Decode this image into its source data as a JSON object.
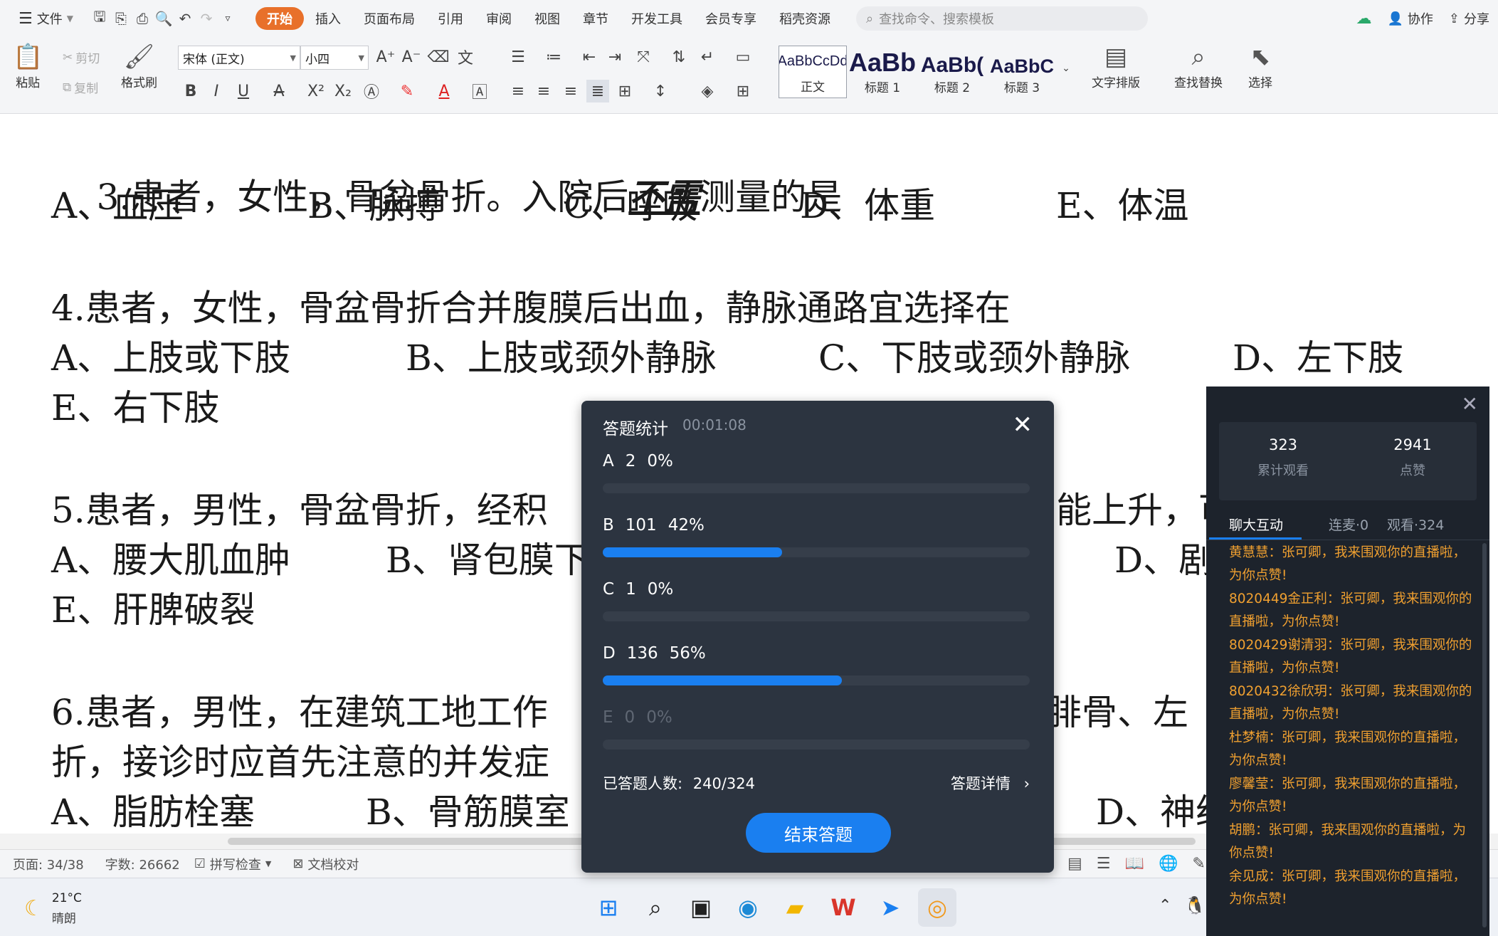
{
  "menu": {
    "file_label": "文件",
    "tabs": [
      "开始",
      "插入",
      "页面布局",
      "引用",
      "审阅",
      "视图",
      "章节",
      "开发工具",
      "会员专享",
      "稻壳资源"
    ],
    "search_placeholder": "查找命令、搜索模板",
    "collab_label": "协作",
    "share_label": "分享"
  },
  "ribbon": {
    "paste": "粘贴",
    "cut": "剪切",
    "copy": "复制",
    "format_painter": "格式刷",
    "font_name": "宋体 (正文)",
    "font_size": "小四",
    "styles": [
      {
        "sample": "AaBbCcDd",
        "label": "正文"
      },
      {
        "sample": "AaBb",
        "label": "标题 1"
      },
      {
        "sample": "AaBb(",
        "label": "标题 2"
      },
      {
        "sample": "AaBbC",
        "label": "标题 3"
      }
    ],
    "text_layout": "文字排版",
    "find_replace": "查找替换",
    "select": "选择"
  },
  "document": {
    "q3": {
      "prefix": "3.患者，女性，骨盆骨折。入院后",
      "emph": "不需",
      "suffix": "测量的是"
    },
    "q3_options": [
      "A、血压",
      "B、脉搏",
      "C、呼吸",
      "D、体重",
      "E、体温"
    ],
    "q4": "4.患者，女性，骨盆骨折合并腹膜后出血，静脉通路宜选择在",
    "q4_options": [
      "A、上肢或下肢",
      "B、上肢或颈外静脉",
      "C、下肢或颈外静脉",
      "D、左下肢",
      "E、右下肢"
    ],
    "q5": "5.患者，男性，骨盆骨折，经积",
    "q5_tail": "能上升，可",
    "q5_options": [
      "A、腰大肌血肿",
      "B、肾包膜下",
      "D、剧",
      "E、肝脾破裂"
    ],
    "q6": "6.患者，男性，在建筑工地工作",
    "q6_tail": "胫腓骨、左",
    "q6_line2": "折，接诊时应首先注意的并发症",
    "q6_options": [
      "A、脂肪栓塞",
      "B、骨筋膜室",
      "D、神经"
    ]
  },
  "status": {
    "page": "页面: 34/38",
    "words": "字数: 26662",
    "spell": "拼写检查",
    "proof": "文档校对"
  },
  "weather": {
    "temp": "21°C",
    "desc": "晴朗"
  },
  "answer_stats": {
    "title": "答题统计",
    "timer": "00:01:08",
    "rows": [
      {
        "option": "A",
        "count": "2",
        "pct": "0%",
        "fraction": 0.0
      },
      {
        "option": "B",
        "count": "101",
        "pct": "42%",
        "fraction": 0.42
      },
      {
        "option": "C",
        "count": "1",
        "pct": "0%",
        "fraction": 0.0
      },
      {
        "option": "D",
        "count": "136",
        "pct": "56%",
        "fraction": 0.56
      },
      {
        "option": "E",
        "count": "0",
        "pct": "0%",
        "fraction": 0.0
      }
    ],
    "answered_label": "已答题人数:",
    "answered_value": "240/324",
    "detail_label": "答题详情",
    "end_button": "结束答题"
  },
  "live_panel": {
    "total_views": "323",
    "total_views_label": "累计观看",
    "likes": "2941",
    "likes_label": "点赞",
    "tabs": [
      "聊大互动",
      "连麦·0",
      "观看·324"
    ],
    "messages": [
      "黄慧慧：张可卿，我来围观你的直播啦，为你点赞!",
      "8020449金正利：张可卿，我来围观你的直播啦，为你点赞!",
      "8020429谢清羽：张可卿，我来围观你的直播啦，为你点赞!",
      "8020432徐欣玥：张可卿，我来围观你的直播啦，为你点赞!",
      "杜梦楠：张可卿，我来围观你的直播啦，为你点赞!",
      "廖馨莹：张可卿，我来围观你的直播啦，为你点赞!",
      "胡鹏：张可卿，我来围观你的直播啦，为你点赞!",
      "余见成：张可卿，我来围观你的直播啦，为你点赞!"
    ]
  },
  "colors": {
    "accent_orange": "#e8702a",
    "progress_blue": "#1a7ff0",
    "chat_orange": "#f0a030"
  }
}
